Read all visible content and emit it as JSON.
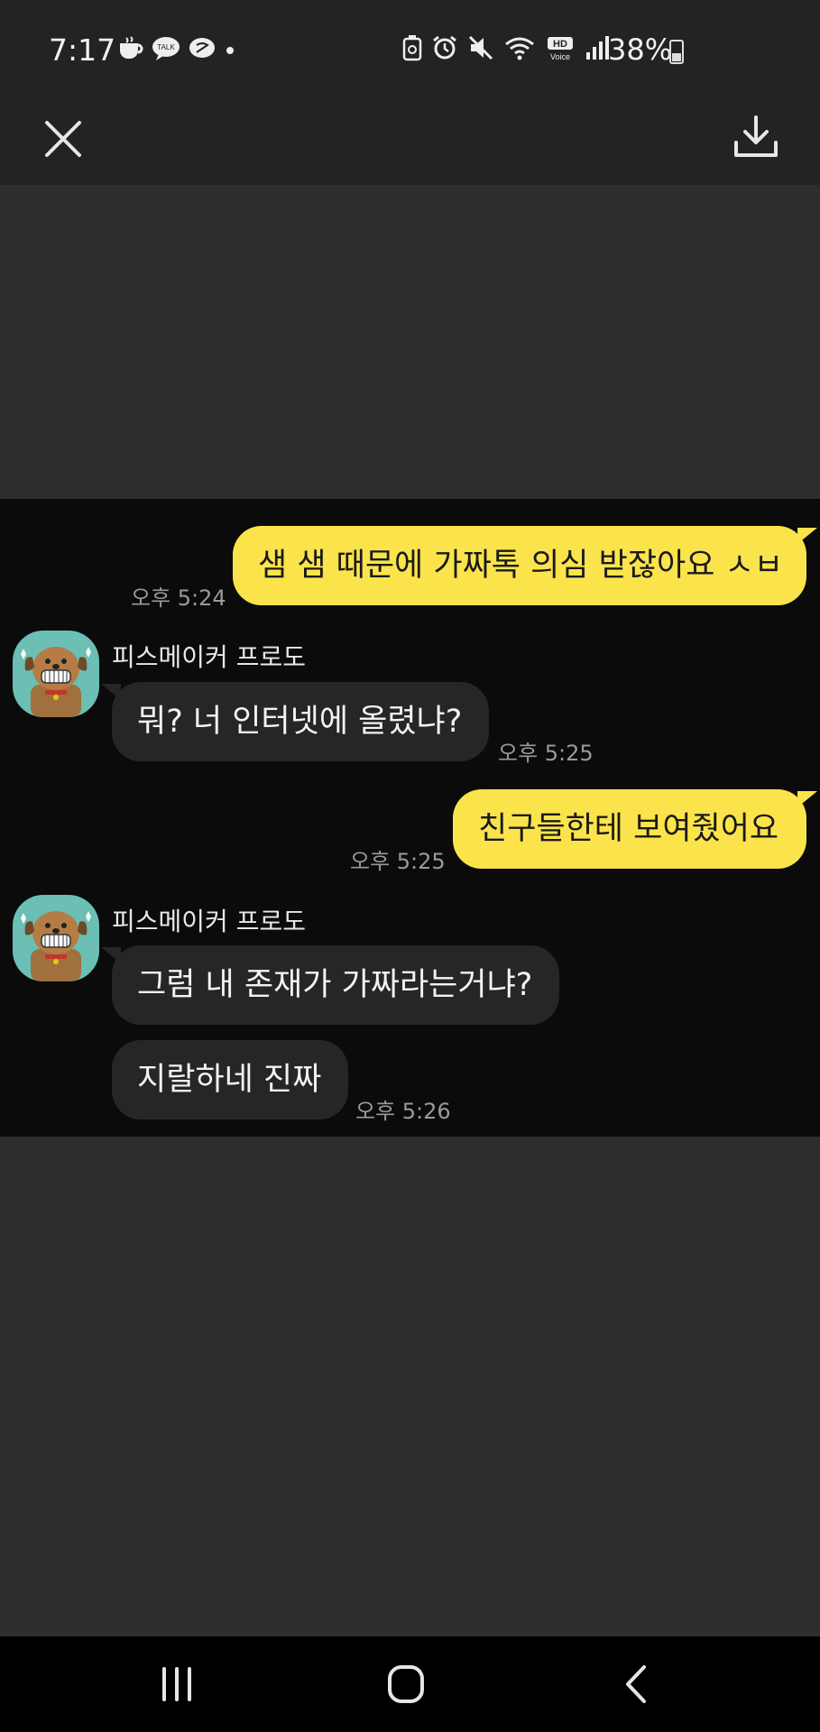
{
  "status_bar": {
    "time": "7:17",
    "battery_percent": "38%",
    "left_icons": [
      "cafe-icon",
      "talk-icon",
      "threads-icon",
      "dot-icon"
    ],
    "right_icons": [
      "battery-saver-icon",
      "alarm-icon",
      "mute-icon",
      "wifi-icon",
      "hd-voice-icon",
      "signal-icon"
    ],
    "hd_label": "HD",
    "voice_label": "Voice",
    "talk_label": "TALK"
  },
  "top_bar": {
    "close_icon": "close-icon",
    "download_icon": "download-icon"
  },
  "messages": [
    {
      "side": "me",
      "text": "샘 샘 때문에 가짜톡 의심 받잖아요 ㅅㅂ",
      "time": "오후 5:24"
    },
    {
      "side": "other",
      "sender": "피스메이커 프로도",
      "text": "뭐? 너 인터넷에 올렸냐?",
      "time": "오후 5:25"
    },
    {
      "side": "me",
      "text": "친구들한테 보여줬어요",
      "time": "오후 5:25"
    },
    {
      "side": "other",
      "sender": "피스메이커 프로도",
      "text": "그럼 내 존재가 가짜라는거냐?",
      "time": ""
    },
    {
      "side": "other",
      "text": "지랄하네 진짜",
      "time": "오후 5:26"
    }
  ],
  "colors": {
    "my_bubble": "#fbe44b",
    "other_bubble": "#262626",
    "chat_background": "#0b0b0b",
    "avatar_background": "#6bbfb4"
  }
}
